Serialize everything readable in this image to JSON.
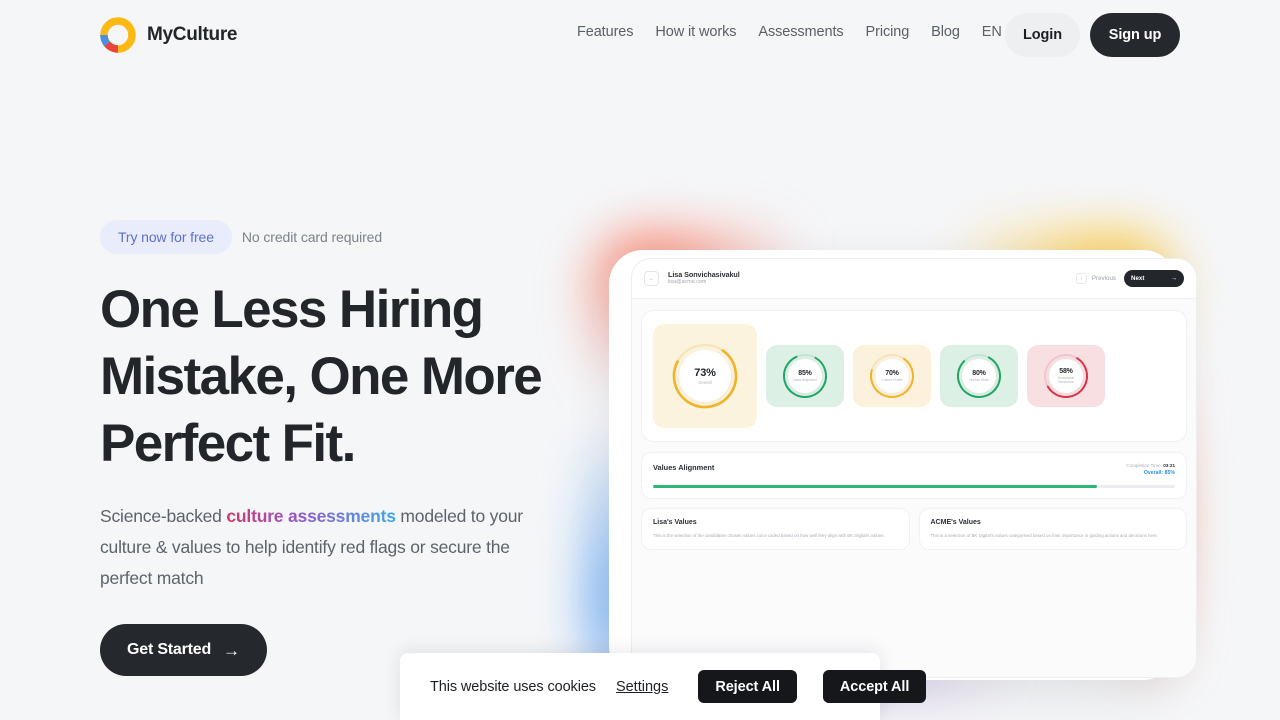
{
  "brand": {
    "name": "MyCulture",
    "logo_icon": "donut-chart-logo"
  },
  "nav": {
    "items": [
      {
        "label": "Features"
      },
      {
        "label": "How it works"
      },
      {
        "label": "Assessments"
      },
      {
        "label": "Pricing"
      },
      {
        "label": "Blog"
      },
      {
        "label": "EN"
      }
    ],
    "login_label": "Login",
    "signup_label": "Sign up"
  },
  "hero": {
    "badge_label": "Try now for free",
    "badge_note": "No credit card required",
    "headline": "One Less Hiring Mistake, One More Perfect Fit.",
    "sub_before": "Science-backed ",
    "sub_highlight": "culture assessments",
    "sub_after": " modeled to your culture & values to help identify red flags or secure the perfect match",
    "cta_label": "Get Started",
    "cta_icon": "arrow-right-icon"
  },
  "mockup": {
    "candidate_name": "Lisa Sonvichasivakul",
    "candidate_email": "lisa@acme.com",
    "back_icon": "arrow-left-icon",
    "prev_label": "Previous",
    "prev_icon": "chevron-left-icon",
    "next_label": "Next",
    "next_icon": "arrow-right-icon",
    "scores": [
      {
        "value": "73%",
        "label": "Overall",
        "ring": "#f0b429",
        "bg": "#fbf3dd",
        "size": "big"
      },
      {
        "value": "85%",
        "label": "Value Alignment",
        "ring": "#22a565",
        "bg": "#ddf0e6",
        "size": "sm"
      },
      {
        "value": "70%",
        "label": "Culture Profile",
        "ring": "#f0b429",
        "bg": "#fbf1dc",
        "size": "sm"
      },
      {
        "value": "80%",
        "label": "Human Skills",
        "ring": "#22a565",
        "bg": "#ddf0e6",
        "size": "sm"
      },
      {
        "value": "58%",
        "label": "Acceptable Behaviors",
        "ring": "#d9334a",
        "bg": "#f8dfe2",
        "size": "sm"
      }
    ],
    "values_alignment": {
      "title": "Values Alignment",
      "completion_label": "Completion Time:",
      "completion_value": "03:21",
      "overall_label": "Overall: 85%",
      "progress_percent": 85,
      "bar_color": "#2fb676"
    },
    "value_cards": [
      {
        "title": "Lisa's Values",
        "desc": "This is the selection of the candidates chosen values color-coded based on how well they align with BK Digital's values."
      },
      {
        "title": "ACME's Values",
        "desc": "This is a selection of BK Digital's values categorised based on their importance in guiding actions and decisions here."
      }
    ]
  },
  "cookie": {
    "text": "This website uses cookies",
    "settings_label": "Settings",
    "reject_label": "Reject All",
    "accept_label": "Accept All"
  }
}
